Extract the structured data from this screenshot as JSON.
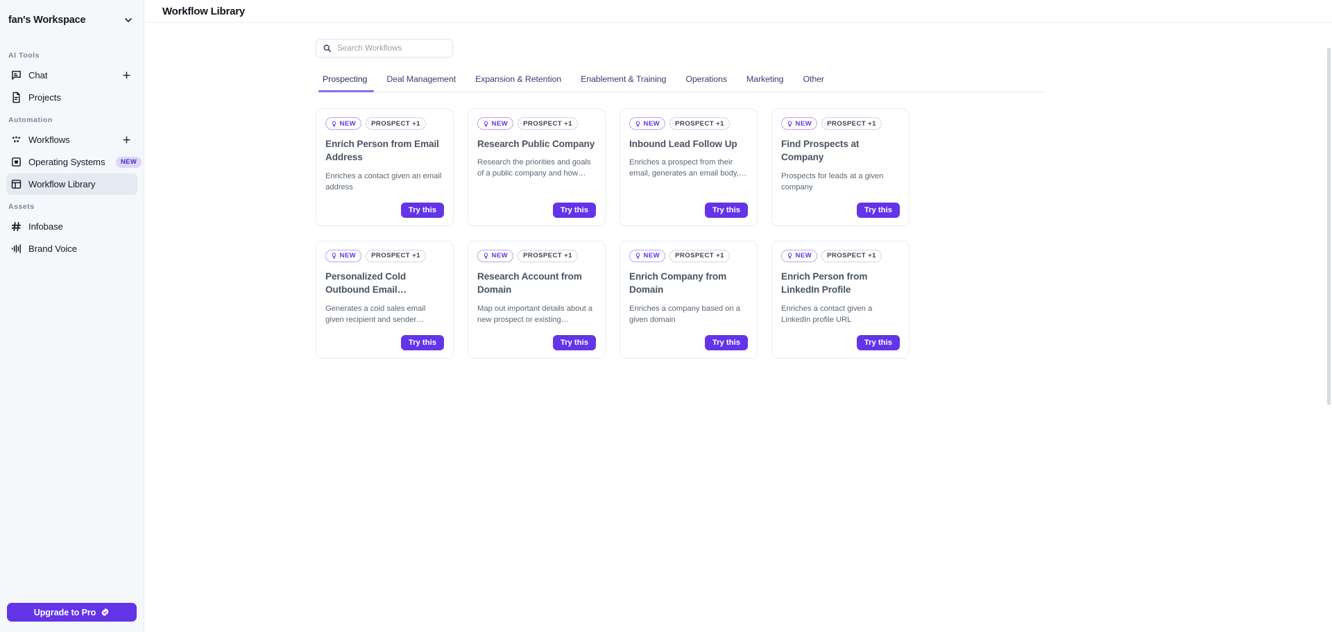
{
  "sidebar": {
    "workspace": {
      "name": "fan's Workspace",
      "chevron_icon": "chevron-down-icon"
    },
    "sections": [
      {
        "label": "AI Tools",
        "items": [
          {
            "label": "Chat",
            "icon": "chat-bubble-icon",
            "action_icon": "plus-icon",
            "active": false
          },
          {
            "label": "Projects",
            "icon": "document-icon",
            "active": false
          }
        ]
      },
      {
        "label": "Automation",
        "items": [
          {
            "label": "Workflows",
            "icon": "workflow-dots-icon",
            "action_icon": "plus-icon",
            "active": false
          },
          {
            "label": "Operating Systems",
            "icon": "panel-icon",
            "badge": "NEW",
            "active": false
          },
          {
            "label": "Workflow Library",
            "icon": "layout-library-icon",
            "active": true
          }
        ]
      },
      {
        "label": "Assets",
        "items": [
          {
            "label": "Infobase",
            "icon": "hash-icon",
            "active": false
          },
          {
            "label": "Brand Voice",
            "icon": "audio-waveform-icon",
            "active": false
          }
        ]
      }
    ],
    "upgrade": {
      "label": "Upgrade to Pro",
      "icon": "verified-badge-icon",
      "color": "#6334e8"
    }
  },
  "header": {
    "title": "Workflow Library"
  },
  "search": {
    "placeholder": "Search Workflows",
    "value": "",
    "icon": "search-icon"
  },
  "tabs": [
    {
      "label": "Prospecting",
      "active": true
    },
    {
      "label": "Deal Management",
      "active": false
    },
    {
      "label": "Expansion & Retention",
      "active": false
    },
    {
      "label": "Enablement & Training",
      "active": false
    },
    {
      "label": "Operations",
      "active": false
    },
    {
      "label": "Marketing",
      "active": false
    },
    {
      "label": "Other",
      "active": false
    }
  ],
  "colors": {
    "accent": "#6334e8",
    "tab_underline": "#8c6ae6",
    "badge_new_bg": "#ddd5fb",
    "sidebar_bg": "#f5f8fa"
  },
  "cards": [
    {
      "new_badge": "NEW",
      "tag": "PROSPECT +1",
      "title": "Enrich Person from Email Address",
      "description": "Enriches a contact given an email address",
      "button": "Try this"
    },
    {
      "new_badge": "NEW",
      "tag": "PROSPECT +1",
      "title": "Research Public Company",
      "description": "Research the priorities and goals of a public company and how…",
      "button": "Try this"
    },
    {
      "new_badge": "NEW",
      "tag": "PROSPECT +1",
      "title": "Inbound Lead Follow Up",
      "description": "Enriches a prospect from their email, generates an email body,…",
      "button": "Try this"
    },
    {
      "new_badge": "NEW",
      "tag": "PROSPECT +1",
      "title": "Find Prospects at Company",
      "description": "Prospects for leads at a given company",
      "button": "Try this"
    },
    {
      "new_badge": "NEW",
      "tag": "PROSPECT +1",
      "title": "Personalized Cold Outbound Email…",
      "description": "Generates a cold sales email given recipient and sender…",
      "button": "Try this"
    },
    {
      "new_badge": "NEW",
      "tag": "PROSPECT +1",
      "title": "Research Account from Domain",
      "description": "Map out important details about a new prospect or existing…",
      "button": "Try this"
    },
    {
      "new_badge": "NEW",
      "tag": "PROSPECT +1",
      "title": "Enrich Company from Domain",
      "description": "Enriches a company based on a given domain",
      "button": "Try this"
    },
    {
      "new_badge": "NEW",
      "tag": "PROSPECT +1",
      "title": "Enrich Person from LinkedIn Profile",
      "description": "Enriches a contact given a LinkedIn profile URL",
      "button": "Try this"
    }
  ]
}
